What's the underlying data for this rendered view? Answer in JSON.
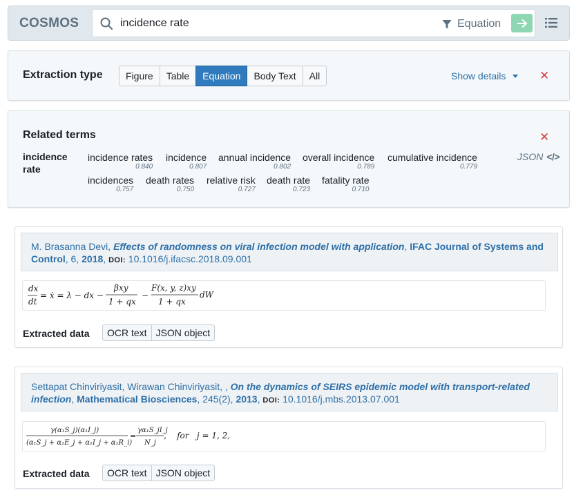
{
  "app": {
    "logo": "COSMOS"
  },
  "search": {
    "query": "incidence rate",
    "filter_label": "Equation"
  },
  "extraction": {
    "label": "Extraction type",
    "options": [
      "Figure",
      "Table",
      "Equation",
      "Body Text",
      "All"
    ],
    "selected": "Equation",
    "show_details": "Show details"
  },
  "related": {
    "title": "Related terms",
    "query": "incidence rate",
    "json_label": "JSON",
    "terms": [
      {
        "name": "incidence rates",
        "score": "0.840"
      },
      {
        "name": "incidence",
        "score": "0.807"
      },
      {
        "name": "annual incidence",
        "score": "0.802"
      },
      {
        "name": "overall incidence",
        "score": "0.789"
      },
      {
        "name": "cumulative incidence",
        "score": "0.779"
      },
      {
        "name": "incidences",
        "score": "0.757"
      },
      {
        "name": "death rates",
        "score": "0.750"
      },
      {
        "name": "relative risk",
        "score": "0.727"
      },
      {
        "name": "death rate",
        "score": "0.723"
      },
      {
        "name": "fatality rate",
        "score": "0.710"
      }
    ]
  },
  "results": [
    {
      "authors": "M. Brasanna Devi, ",
      "title": "Effects of randomness on viral infection model with application",
      "journal": "IFAC Journal of Systems and Control",
      "volume": ", 6, ",
      "year": "2018",
      "doi_label": "DOI:",
      "doi": "10.1016/j.ifacsc.2018.09.001",
      "extracted_label": "Extracted data",
      "buttons": [
        "OCR text",
        "JSON object"
      ]
    },
    {
      "authors": "Settapat Chinviriyasit, Wirawan Chinviriyasit, , ",
      "title": "On the dynamics of SEIRS epidemic model with transport-related infection",
      "journal": "Mathematical Biosciences",
      "volume": ", 245(2), ",
      "year": "2013",
      "doi_label": "DOI:",
      "doi": "10.1016/j.mbs.2013.07.001",
      "extracted_label": "Extracted data",
      "buttons": [
        "OCR text",
        "JSON object"
      ]
    }
  ],
  "equations": {
    "eq1": {
      "lhs_num": "dx",
      "lhs_den": "dt",
      "mid": "= ẋ = λ − dx −",
      "f1_num": "βxy",
      "f1_den": "1 + qx",
      "minus": "−",
      "f2_num": "F(x, y, z)xy",
      "f2_den": "1 + qx",
      "tail": "dW"
    },
    "eq2": {
      "f1_num": "γ(α₁S_j)(α₁I_j)",
      "f1_den": "(α₁S_j + α₁E_j + α₁I_j + α₁R_i)",
      "eq": "=",
      "f2_num": "γα₁S_jI_j",
      "f2_den": "N_j",
      "tail": ",    for   j = 1, 2,"
    }
  },
  "colors": {
    "accent": "#2f7bbd",
    "link": "#2d6fa8",
    "close": "#d13b3b",
    "go": "#8fd7b4"
  }
}
